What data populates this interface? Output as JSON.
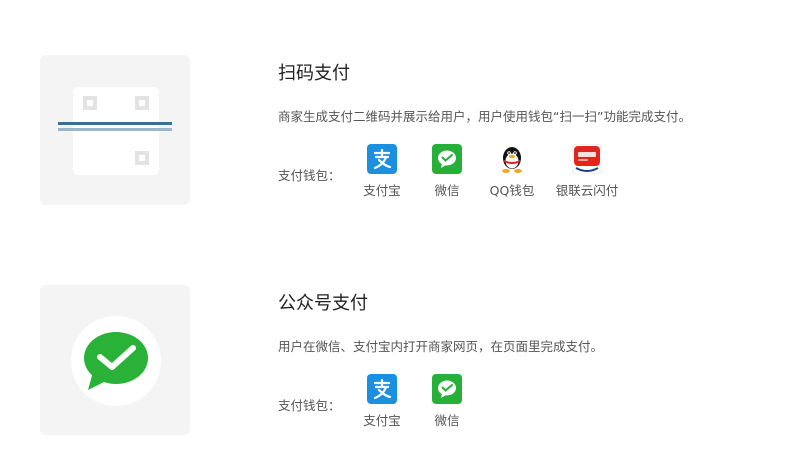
{
  "wallet_label": "支付钱包：",
  "methods": [
    {
      "title": "扫码支付",
      "description": "商家生成支付二维码并展示给用户，用户使用钱包“扫一扫”功能完成支付。",
      "wallets": [
        "支付宝",
        "微信",
        "QQ钱包",
        "银联云闪付"
      ]
    },
    {
      "title": "公众号支付",
      "description": "用户在微信、支付宝内打开商家网页，在页面里完成支付。",
      "wallets": [
        "支付宝",
        "微信"
      ]
    }
  ],
  "icons": {
    "alipay": "alipay-icon",
    "wechat": "wechat-icon",
    "qq": "qq-penguin-icon",
    "unionpay": "unionpay-cloud-quickpass-icon",
    "scan": "qr-scan-icon",
    "wechat_large": "wechat-pay-icon"
  },
  "colors": {
    "alipay": "#1b8fe0",
    "wechat": "#26b03a",
    "unionpay": "#e1251b",
    "thumb_bg": "#f4f4f4"
  }
}
